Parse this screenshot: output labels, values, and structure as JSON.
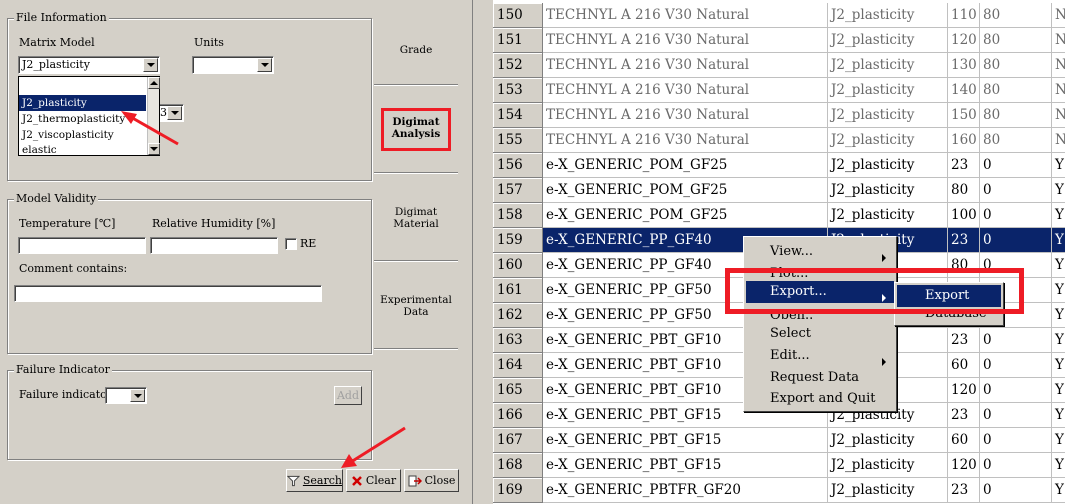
{
  "left_panel": {
    "file_info": {
      "title": "File Information",
      "matrix_model_label": "Matrix Model",
      "matrix_model_value": "J2_plasticity",
      "units_label": "Units",
      "units_value": "",
      "dropdown_options": [
        "J2_plasticity",
        "J2_thermoplasticity",
        "J2_viscoplasticity",
        "elastic"
      ],
      "dropdown_selected": "J2_plasticity",
      "hidden_combo_value": "3"
    },
    "model_validity": {
      "title": "Model Validity",
      "temperature_label": "Temperature [℃]",
      "humidity_label": "Relative Humidity [%]",
      "re_label": "RE",
      "comment_label": "Comment contains:"
    },
    "failure": {
      "title": "Failure Indicator",
      "label": "Failure indicator:",
      "add_label": "Add"
    },
    "tabs": {
      "grade": "Grade",
      "digimat_analysis_1": "Digimat",
      "digimat_analysis_2": "Analysis",
      "digimat_material_1": "Digimat",
      "digimat_material_2": "Material",
      "experimental_data_1": "Experimental",
      "experimental_data_2": "Data"
    },
    "buttons": {
      "search": "Search",
      "clear": "Clear",
      "close": "Close"
    }
  },
  "grid": {
    "rows": [
      {
        "id": "150",
        "name": "TECHNYL A 216 V30 Natural",
        "model": "J2_plasticity",
        "temp": "110",
        "hum": "80",
        "flag": "N"
      },
      {
        "id": "151",
        "name": "TECHNYL A 216 V30 Natural",
        "model": "J2_plasticity",
        "temp": "120",
        "hum": "80",
        "flag": "N"
      },
      {
        "id": "152",
        "name": "TECHNYL A 216 V30 Natural",
        "model": "J2_plasticity",
        "temp": "130",
        "hum": "80",
        "flag": "N"
      },
      {
        "id": "153",
        "name": "TECHNYL A 216 V30 Natural",
        "model": "J2_plasticity",
        "temp": "140",
        "hum": "80",
        "flag": "N"
      },
      {
        "id": "154",
        "name": "TECHNYL A 216 V30 Natural",
        "model": "J2_plasticity",
        "temp": "150",
        "hum": "80",
        "flag": "N"
      },
      {
        "id": "155",
        "name": "TECHNYL A 216 V30 Natural",
        "model": "J2_plasticity",
        "temp": "160",
        "hum": "80",
        "flag": "N"
      },
      {
        "id": "156",
        "name": "e-X_GENERIC_POM_GF25",
        "model": "J2_plasticity",
        "temp": "23",
        "hum": "0",
        "flag": "Y"
      },
      {
        "id": "157",
        "name": "e-X_GENERIC_POM_GF25",
        "model": "J2_plasticity",
        "temp": "80",
        "hum": "0",
        "flag": "Y"
      },
      {
        "id": "158",
        "name": "e-X_GENERIC_POM_GF25",
        "model": "J2_plasticity",
        "temp": "100",
        "hum": "0",
        "flag": "Y"
      },
      {
        "id": "159",
        "name": "e-X_GENERIC_PP_GF40",
        "model": "J2_plasticity",
        "temp": "23",
        "hum": "0",
        "flag": "Y"
      },
      {
        "id": "160",
        "name": "e-X_GENERIC_PP_GF40",
        "model": "",
        "temp": "80",
        "hum": "0",
        "flag": "Y"
      },
      {
        "id": "161",
        "name": "e-X_GENERIC_PP_GF50",
        "model": "",
        "temp": "",
        "hum": "0",
        "flag": "Y"
      },
      {
        "id": "162",
        "name": "e-X_GENERIC_PP_GF50",
        "model": "",
        "temp": "",
        "hum": "0",
        "flag": "Y"
      },
      {
        "id": "163",
        "name": "e-X_GENERIC_PBT_GF10",
        "model": "",
        "temp": "23",
        "hum": "0",
        "flag": "Y"
      },
      {
        "id": "164",
        "name": "e-X_GENERIC_PBT_GF10",
        "model": "",
        "temp": "60",
        "hum": "0",
        "flag": "Y"
      },
      {
        "id": "165",
        "name": "e-X_GENERIC_PBT_GF10",
        "model": "",
        "temp": "120",
        "hum": "0",
        "flag": "Y"
      },
      {
        "id": "166",
        "name": "e-X_GENERIC_PBT_GF15",
        "model": "J2_plasticity",
        "temp": "23",
        "hum": "0",
        "flag": "Y"
      },
      {
        "id": "167",
        "name": "e-X_GENERIC_PBT_GF15",
        "model": "J2_plasticity",
        "temp": "60",
        "hum": "0",
        "flag": "Y"
      },
      {
        "id": "168",
        "name": "e-X_GENERIC_PBT_GF15",
        "model": "J2_plasticity",
        "temp": "120",
        "hum": "0",
        "flag": "Y"
      },
      {
        "id": "169",
        "name": "e-X_GENERIC_PBTFR_GF20",
        "model": "J2_plasticity",
        "temp": "23",
        "hum": "0",
        "flag": "Y"
      }
    ]
  },
  "context_menu": {
    "items": [
      "View...",
      "Plot...",
      "Export...",
      "Open..",
      "Select",
      "Edit...",
      "Request Data",
      "Export and Quit"
    ],
    "highlighted": "Export...",
    "submenu_items": [
      "Export",
      "Database"
    ]
  },
  "colors": {
    "highlight": "#0a246a",
    "annotation": "#ee1c25",
    "panel": "#d4d0c8"
  }
}
